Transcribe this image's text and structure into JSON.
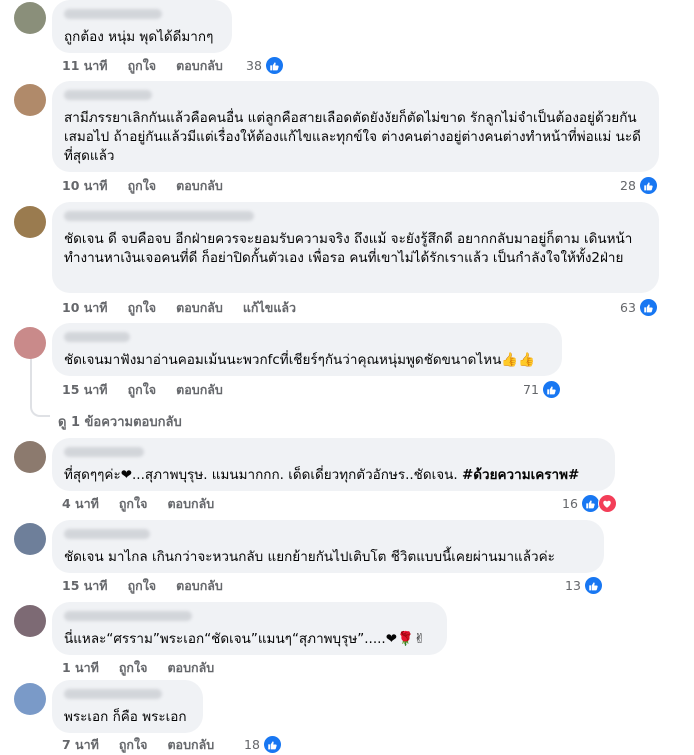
{
  "comments": [
    {
      "text": "ถูกต้อง หนุ่ม พุดได้ดีมากๆ",
      "time": "11 นาที",
      "like": "ถูกใจ",
      "reply": "ตอบกลับ",
      "edit": "",
      "reactions": "38",
      "avatar_color": "#8a8f7a"
    },
    {
      "text": "สามีภรรยาเลิกกันแล้วคือคนอื่น แต่ลูกคือสายเลือดตัดยังงัยก็ตัดไม่ขาด รักลูกไม่จำเป็นต้องอยู่ด้วยกันเสมอไป ถ้าอยู่กันแล้วมีแต่เรื่องให้ต้องแก้ไขและทุกข์ใจ ต่างคนต่างอยู่ต่างคนต่างทำหน้าที่พ่อแม่ นะดีที่สุดแล้ว",
      "time": "10 นาที",
      "like": "ถูกใจ",
      "reply": "ตอบกลับ",
      "edit": "",
      "reactions": "28",
      "avatar_color": "#b08a6a"
    },
    {
      "text": "ชัดเจน ดี จบคือจบ อีกฝ่ายควรจะยอมรับความจริง ถึงแม้ จะยังรู้สึกดี อยากกลับมาอยู่ก็ตาม เดินหน้าทำงานหาเงินเจอคนที่ดี ก็อย่าปิดกั้นตัวเอง เพื่อรอ คนที่เขาไม่ได้รักเราแล้ว เป็นกำลังใจให้ทั้ง2ฝ่าย",
      "time": "10 นาที",
      "like": "ถูกใจ",
      "reply": "ตอบกลับ",
      "edit": "แก้ไขแล้ว",
      "reactions": "63",
      "avatar_color": "#9a7b4f"
    },
    {
      "text": "ชัดเจนมาฟังมาอ่านคอมเม้นนะพวกfcที่เชียร์ๆกันว่าคุณหนุ่มพูดชัดขนาดไหน👍👍",
      "time": "15 นาที",
      "like": "ถูกใจ",
      "reply": "ตอบกลับ",
      "edit": "",
      "reactions": "71",
      "avatar_color": "#c98a8a"
    },
    {
      "text_pre": "ที่สุดๆๆค่ะ❤...สุภาพบุรุษ. แมนมากกก. เด็ดเดี่ยวทุกตัวอักษร..ชัดเจน. ",
      "hashtag": "#ด้วยความเคราพ#",
      "time": "4 นาที",
      "like": "ถูกใจ",
      "reply": "ตอบกลับ",
      "edit": "",
      "reactions": "16",
      "avatar_color": "#8c7a6e"
    },
    {
      "text": "ชัดเจน มาไกล เกินกว่าจะหวนกลับ แยกย้ายกันไปเติบโต ชีวิตแบบนี้เคยผ่านมาแล้วค่ะ",
      "time": "15 นาที",
      "like": "ถูกใจ",
      "reply": "ตอบกลับ",
      "edit": "",
      "reactions": "13",
      "avatar_color": "#6e7f9a"
    },
    {
      "text": "นี่แหละ“ศรราม”พระเอก“ชัดเจน”แมนๆ“สุภาพบุรุษ”.....❤🌹✌",
      "time": "1 นาที",
      "like": "ถูกใจ",
      "reply": "ตอบกลับ",
      "edit": "",
      "reactions": "",
      "avatar_color": "#7d6a74"
    },
    {
      "text": "พระเอก ก็คือ พระเอก",
      "time": "7 นาที",
      "like": "ถูกใจ",
      "reply": "ตอบกลับ",
      "edit": "",
      "reactions": "18",
      "avatar_color": "#7a9ac8"
    }
  ],
  "view_replies": "ดู 1 ข้อความตอบกลับ",
  "colors": {
    "bubble": "#f0f2f5",
    "meta": "#65676b",
    "like": "#1877f2",
    "love": "#f33e58"
  },
  "icons": {
    "like": "thumbs-up-icon",
    "love": "heart-icon"
  }
}
